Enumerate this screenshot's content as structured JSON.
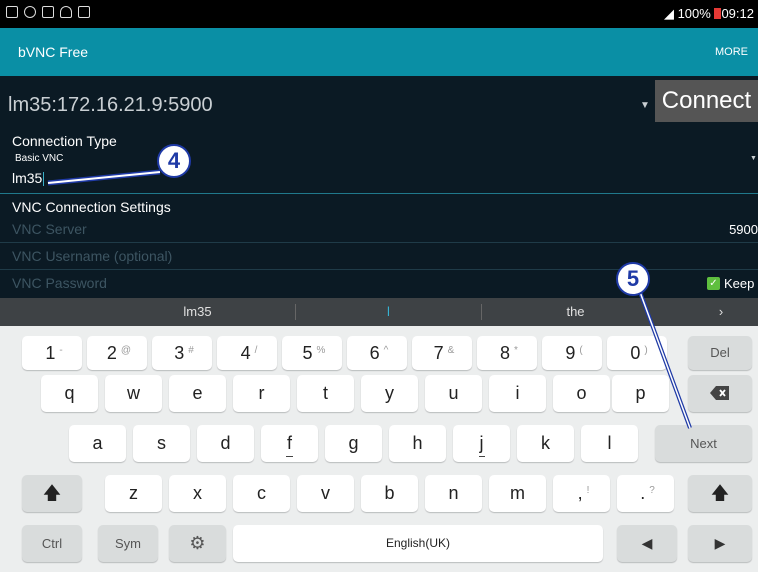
{
  "status_bar": {
    "battery": "100%",
    "time": "09:12",
    "icons": [
      "keyboard-icon",
      "blocked-icon",
      "image-icon",
      "cloud-icon",
      "bag-icon",
      "wifi-icon",
      "battery-icon"
    ]
  },
  "app_bar": {
    "title": "bVNC Free",
    "more": "MORE"
  },
  "connection": {
    "selected": "lm35:172.16.21.9:5900",
    "connect_label": "Connect",
    "type_label": "Connection Type",
    "type_value": "Basic VNC",
    "nickname": "lm35"
  },
  "vnc_settings": {
    "heading": "VNC Connection Settings",
    "server_placeholder": "VNC Server",
    "port": "5900",
    "username_placeholder": "VNC Username (optional)",
    "password_placeholder": "VNC Password",
    "keep_label": "Keep"
  },
  "suggestions": [
    "lm35",
    "l",
    "the"
  ],
  "suggestion_more": "›",
  "keyboard": {
    "number_row": [
      {
        "main": "1",
        "alt": "-"
      },
      {
        "main": "2",
        "alt": "@"
      },
      {
        "main": "3",
        "alt": "#"
      },
      {
        "main": "4",
        "alt": "/"
      },
      {
        "main": "5",
        "alt": "%"
      },
      {
        "main": "6",
        "alt": "^"
      },
      {
        "main": "7",
        "alt": "&"
      },
      {
        "main": "8",
        "alt": "*"
      },
      {
        "main": "9",
        "alt": "("
      },
      {
        "main": "0",
        "alt": ")"
      }
    ],
    "del_label": "Del",
    "row_q": [
      "q",
      "w",
      "e",
      "r",
      "t",
      "y",
      "u",
      "i",
      "o",
      "p"
    ],
    "row_a": [
      "a",
      "s",
      "d",
      "f",
      "g",
      "h",
      "j",
      "k",
      "l"
    ],
    "next_label": "Next",
    "row_z": [
      "z",
      "x",
      "c",
      "v",
      "b",
      "n",
      "m"
    ],
    "comma": {
      "main": ",",
      "alt": "!"
    },
    "period": {
      "main": ".",
      "alt": "?"
    },
    "ctrl_label": "Ctrl",
    "sym_label": "Sym",
    "space_label": "English(UK)"
  },
  "annotations": {
    "callout_4": "4",
    "callout_5": "5"
  },
  "colors": {
    "app_bar": "#0a8fa5",
    "background": "#0b1a24",
    "annotation": "#1f3aa6",
    "checkbox": "#5fbf3f"
  }
}
